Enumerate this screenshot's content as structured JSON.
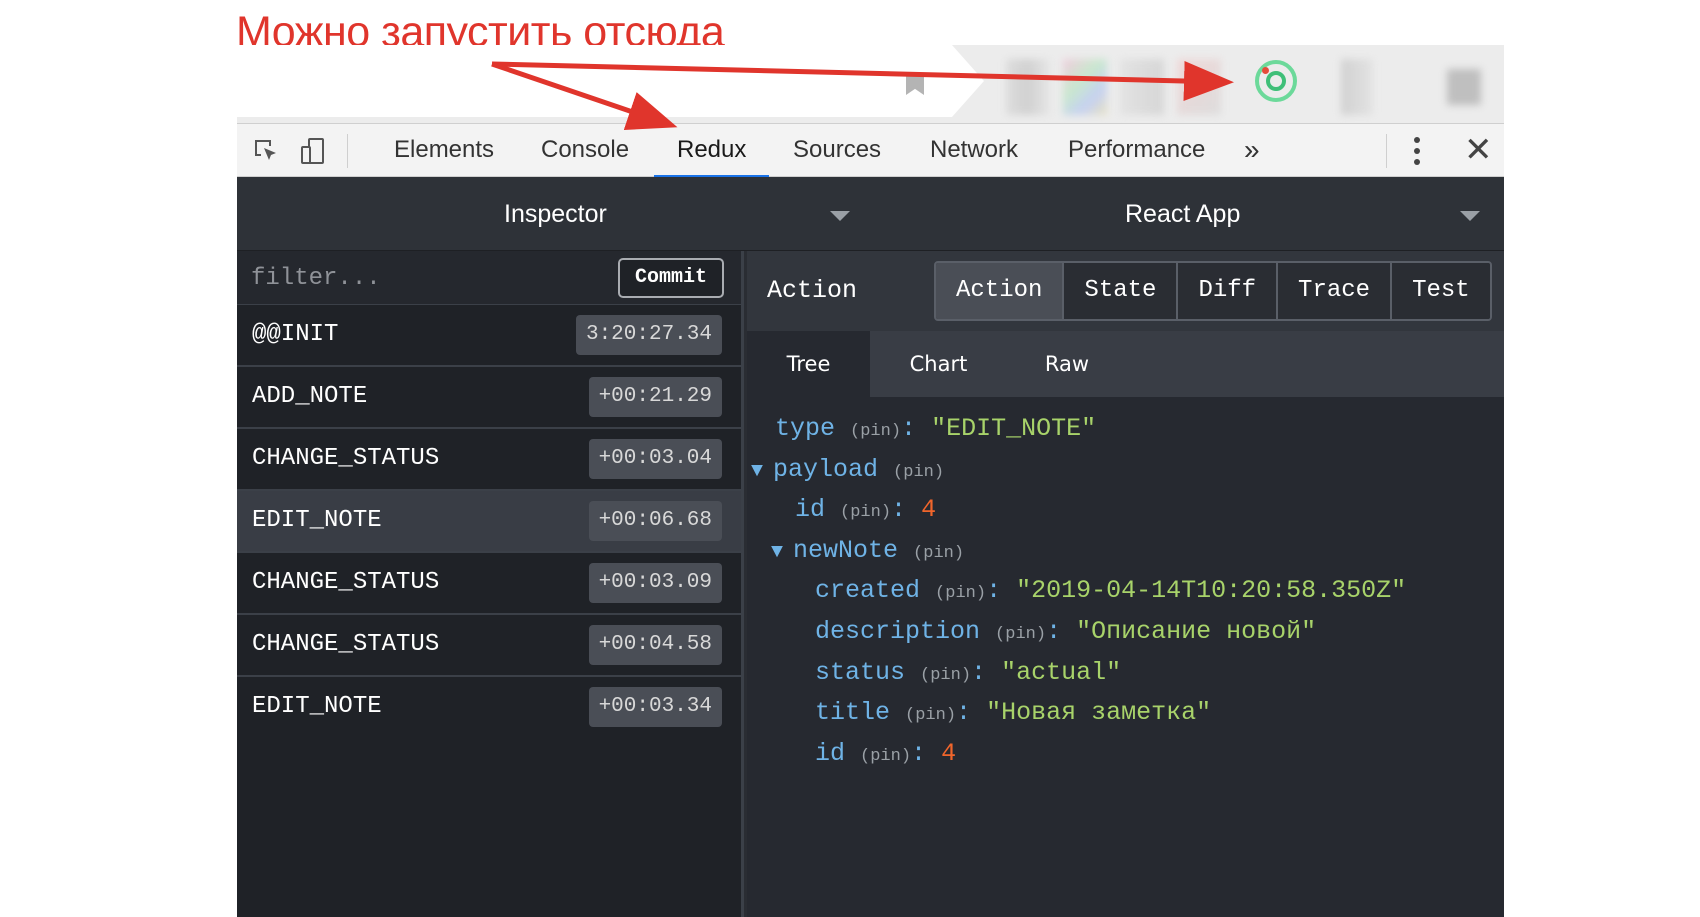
{
  "annotation": {
    "text": "Можно запустить отсюда",
    "color": "#e0352c"
  },
  "devtools": {
    "tabs": [
      {
        "label": "Elements"
      },
      {
        "label": "Console"
      },
      {
        "label": "Redux"
      },
      {
        "label": "Sources"
      },
      {
        "label": "Network"
      },
      {
        "label": "Performance"
      }
    ],
    "active_tab": "Redux",
    "more_tabs_icon": "»",
    "close_icon": "✕"
  },
  "redux": {
    "monitor_selector": "Inspector",
    "instance_selector": "React App",
    "filter_placeholder": "filter...",
    "commit_label": "Commit",
    "actions": [
      {
        "name": "@@INIT",
        "time": "3:20:27.34"
      },
      {
        "name": "ADD_NOTE",
        "time": "+00:21.29"
      },
      {
        "name": "CHANGE_STATUS",
        "time": "+00:03.04"
      },
      {
        "name": "EDIT_NOTE",
        "time": "+00:06.68"
      },
      {
        "name": "CHANGE_STATUS",
        "time": "+00:03.09"
      },
      {
        "name": "CHANGE_STATUS",
        "time": "+00:04.58"
      },
      {
        "name": "EDIT_NOTE",
        "time": "+00:03.34"
      }
    ],
    "selected_action_index": 3,
    "detail_header_label": "Action",
    "detail_tabs": [
      "Action",
      "State",
      "Diff",
      "Trace",
      "Test"
    ],
    "active_detail_tab": "Action",
    "view_tabs": [
      "Tree",
      "Chart",
      "Raw"
    ],
    "active_view_tab": "Tree",
    "pin_label": "(pin)",
    "tree": {
      "type_key": "type",
      "type_value": "\"EDIT_NOTE\"",
      "payload_key": "payload",
      "id_key": "id",
      "id_value": "4",
      "newnote_key": "newNote",
      "created_key": "created",
      "created_value": "\"2019-04-14T10:20:58.350Z\"",
      "description_key": "description",
      "description_value": "\"Описание новой\"",
      "status_key": "status",
      "status_value": "\"actual\"",
      "title_key": "title",
      "title_value": "\"Новая заметка\"",
      "note_id_key": "id",
      "note_id_value": "4"
    }
  },
  "colors": {
    "accent_tab_underline": "#1a73e8",
    "tree_key": "#6fb3e6",
    "tree_string": "#a8d36a",
    "tree_number": "#f0652b"
  }
}
